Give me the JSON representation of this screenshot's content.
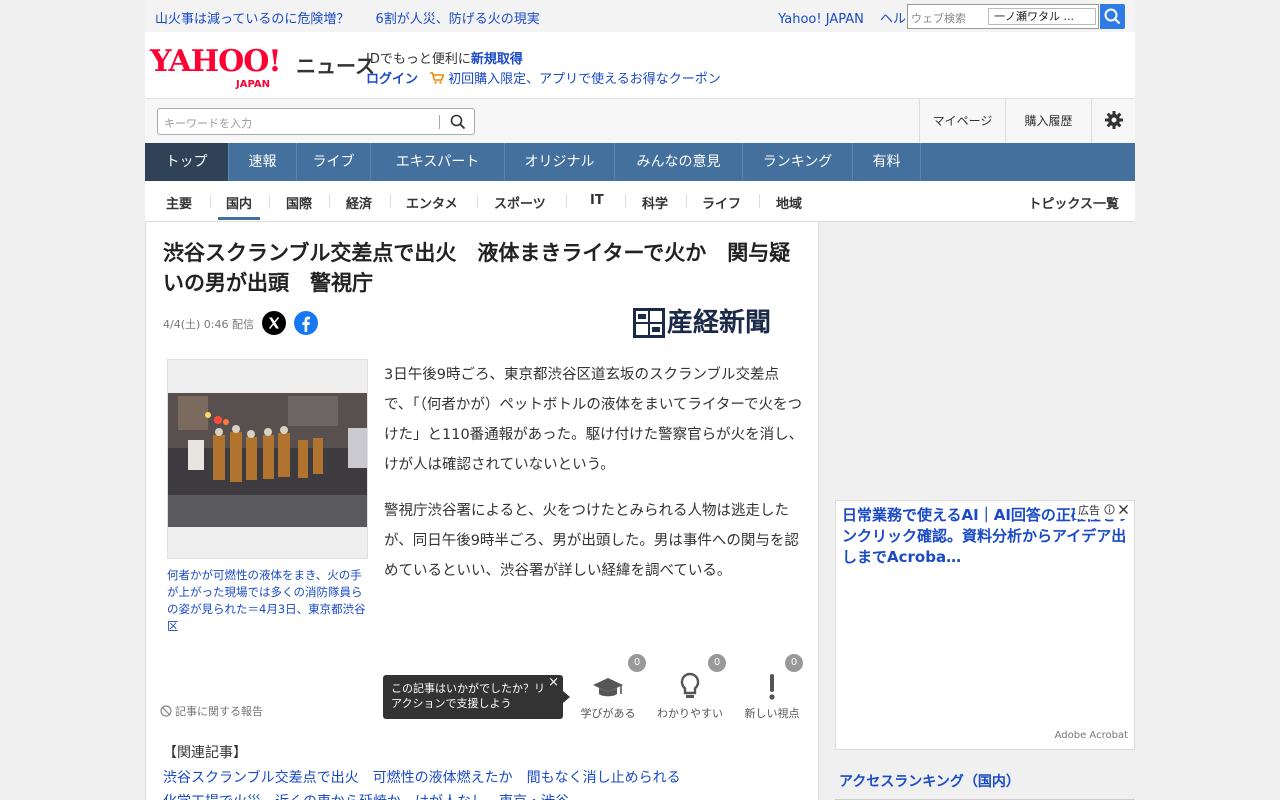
{
  "topbar": {
    "news_links": [
      "山火事は減っているのに危険増？",
      "6割が人災、防げる火の現実"
    ],
    "yahoo_japan": "Yahoo! JAPAN",
    "help": "ヘルプ",
    "web_search_placeholder": "ウェブ検索",
    "web_search_value": "一ノ瀬ワタル ..."
  },
  "header": {
    "logo_text": "YAHOO!",
    "logo_sub": "JAPAN",
    "service": "ニュース",
    "id_prefix": "IDでもっと便利に",
    "id_link": "新規取得",
    "login": "ログイン",
    "coupon": "初回購入限定、アプリで使えるお得なクーポン"
  },
  "searchrow": {
    "placeholder": "キーワードを入力",
    "mypage": "マイページ",
    "history": "購入履歴"
  },
  "nav": {
    "tabs": [
      "トップ",
      "速報",
      "ライブ",
      "エキスパート",
      "オリジナル",
      "みんなの意見",
      "ランキング",
      "有料"
    ]
  },
  "subnav": {
    "items": [
      "主要",
      "国内",
      "国際",
      "経済",
      "エンタメ",
      "スポーツ",
      "IT",
      "科学",
      "ライフ",
      "地域"
    ],
    "topics": "トピックス一覧"
  },
  "article": {
    "title": "渋谷スクランブル交差点で出火　液体まきライターで火か　関与疑いの男が出頭　警視庁",
    "date": "4/4(土) 0:46 配信",
    "publisher": "産経新聞",
    "caption": "何者かが可燃性の液体をまき、火の手が上がった現場では多くの消防隊員らの姿が見られた＝4月3日、東京都渋谷区",
    "paragraphs": [
      "3日午後9時ごろ、東京都渋谷区道玄坂のスクランブル交差点で、「（何者かが）ペットボトルの液体をまいてライターで火をつけた」と110番通報があった。駆け付けた警察官らが火を消し、けが人は確認されていないという。",
      "警視庁渋谷署によると、火をつけたとみられる人物は逃走したが、同日午後9時半ごろ、男が出頭した。男は事件への関与を認めているといい、渋谷署が詳しい経緯を調べている。"
    ],
    "report": "記事に関する報告",
    "tooltip": "この記事はいかがでしたか？リアクションで支援しよう",
    "tooltip_close": "×",
    "reactions": [
      {
        "label": "学びがある",
        "count": "0"
      },
      {
        "label": "わかりやすい",
        "count": "0"
      },
      {
        "label": "新しい視点",
        "count": "0"
      }
    ],
    "related_heading": "【関連記事】",
    "related": [
      "渋谷スクランブル交差点で出火　可燃性の液体燃えたか　間もなく消し止められる",
      "化学工場で火災　近くの車から延焼か　けが人なし　東京・渋谷"
    ]
  },
  "ad": {
    "headline": "日常業務で使えるAI｜AI回答の正確性をワンクリック確認。資料分析からアイデア出しまでAcroba…",
    "badge": "広告",
    "source": "Adobe Acrobat"
  },
  "ranking": {
    "title": "アクセスランキング（国内）"
  },
  "colors": {
    "brand_red": "#ff0033",
    "link_blue": "#1a4ac6",
    "nav_blue": "#43709c",
    "nav_active": "#2f4257"
  }
}
